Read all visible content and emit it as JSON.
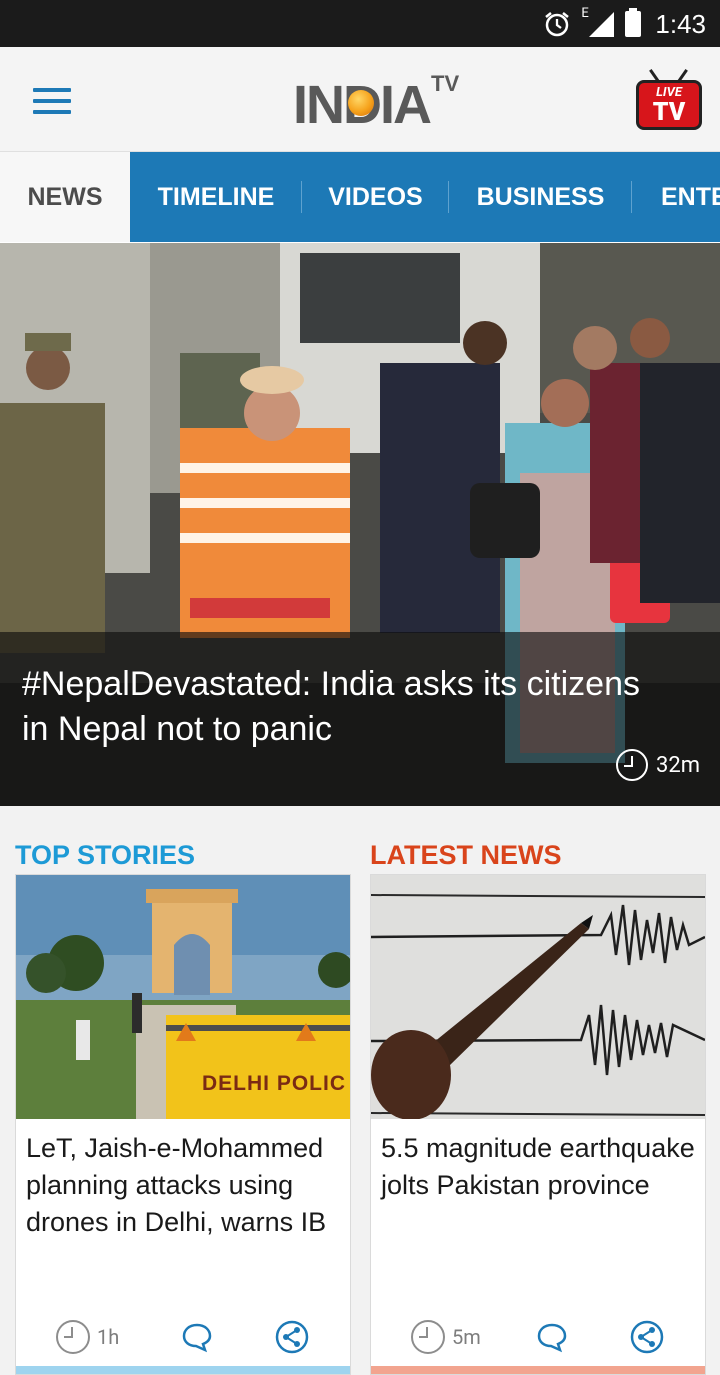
{
  "status_bar": {
    "time": "1:43",
    "network_label": "E",
    "icons": [
      "alarm-icon",
      "signal-icon",
      "battery-icon"
    ]
  },
  "header": {
    "logo_main_left": "IN",
    "logo_main_right": "IA",
    "logo_sup": "TV",
    "live_badge_top": "LIVE",
    "live_badge_bottom": "TV"
  },
  "tabs": [
    {
      "label": "NEWS",
      "active": true
    },
    {
      "label": "TIMELINE",
      "active": false
    },
    {
      "label": "VIDEOS",
      "active": false
    },
    {
      "label": "BUSINESS",
      "active": false
    },
    {
      "label": "ENTE",
      "active": false
    }
  ],
  "hero": {
    "title": "#NepalDevastated: India asks its citizens in Nepal not to panic",
    "time": "32m"
  },
  "sections": {
    "top_stories": {
      "heading": "TOP STORIES",
      "color": "#1d9ad6",
      "image_sign_text": "DELHI POLIC",
      "title": "LeT, Jaish-e-Mohammed planning attacks using drones in Delhi, warns IB",
      "time": "1h"
    },
    "latest_news": {
      "heading": "LATEST NEWS",
      "color": "#d9441b",
      "title": "5.5 magnitude earthquake jolts Pakistan province",
      "time": "5m"
    }
  },
  "colors": {
    "brand_blue": "#1d79b6",
    "live_red": "#d7151b",
    "top_bar": "#9ed4ef",
    "latest_bar": "#f2a48f"
  }
}
